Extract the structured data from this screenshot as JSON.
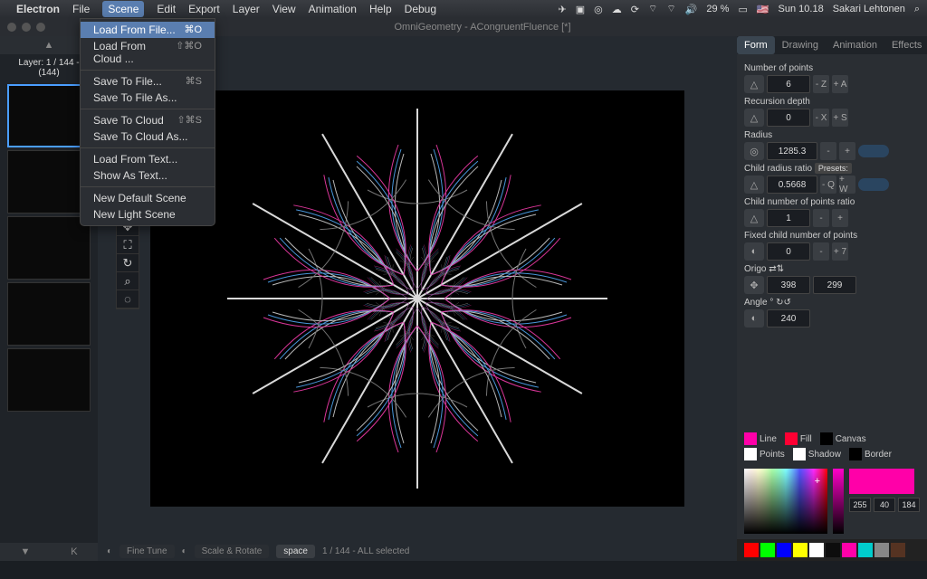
{
  "menubar": {
    "app": "Electron",
    "items": [
      "File",
      "Scene",
      "Edit",
      "Export",
      "Layer",
      "View",
      "Animation",
      "Help",
      "Debug"
    ],
    "status": {
      "battery": "29 %",
      "time": "Sun 10.18",
      "user": "Sakari Lehtonen"
    }
  },
  "dropdown": {
    "groups": [
      [
        {
          "label": "Load From File...",
          "shortcut": "⌘O",
          "hl": true
        },
        {
          "label": "Load From Cloud ...",
          "shortcut": "⇧⌘O"
        }
      ],
      [
        {
          "label": "Save To File...",
          "shortcut": "⌘S"
        },
        {
          "label": "Save To File As..."
        }
      ],
      [
        {
          "label": "Save To Cloud",
          "shortcut": "⇧⌘S"
        },
        {
          "label": "Save To Cloud As..."
        }
      ],
      [
        {
          "label": "Load From Text..."
        },
        {
          "label": "Show As Text..."
        }
      ],
      [
        {
          "label": "New Default Scene"
        },
        {
          "label": "New Light Scene"
        }
      ]
    ]
  },
  "window": {
    "title": "OmniGeometry - ACongruentFluence [*]"
  },
  "leftbar": {
    "layer_line1": "Layer: 1 / 144 -",
    "layer_line2": "(144)",
    "k": "K"
  },
  "footer": {
    "fine_tune": "Fine Tune",
    "scale_rotate": "Scale & Rotate",
    "space": "space",
    "status": "1 / 144 - ALL selected"
  },
  "tabs": [
    "Form",
    "Drawing",
    "Animation",
    "Effects"
  ],
  "form": {
    "num_points": {
      "label": "Number of points",
      "value": "6",
      "minus": "- Z",
      "plus": "+ A"
    },
    "recursion": {
      "label": "Recursion depth",
      "value": "0",
      "minus": "- X",
      "plus": "+ S"
    },
    "radius": {
      "label": "Radius",
      "value": "1285.3"
    },
    "child_radius": {
      "label": "Child radius ratio",
      "presets": "Presets:",
      "value": "0.5668",
      "minus": "- Q",
      "plus": "+ W"
    },
    "child_points": {
      "label": "Child number of points ratio",
      "value": "1"
    },
    "fixed_child": {
      "label": "Fixed child number of points",
      "value": "0",
      "plus": "+ 7"
    },
    "origo": {
      "label": "Origo",
      "x": "398",
      "y": "299"
    },
    "angle": {
      "label": "Angle °",
      "value": "240"
    }
  },
  "swatches": {
    "line": "Line",
    "fill": "Fill",
    "canvas": "Canvas",
    "points": "Points",
    "shadow": "Shadow",
    "border": "Border"
  },
  "rgb": {
    "r": "255",
    "g": "40",
    "b": "184"
  },
  "palette": [
    "#ff0000",
    "#00ff00",
    "#0000ff",
    "#ffff00",
    "#ffffff",
    "#0d0d0d",
    "#ff00a8",
    "#00cccc",
    "#888888",
    "#553322"
  ]
}
